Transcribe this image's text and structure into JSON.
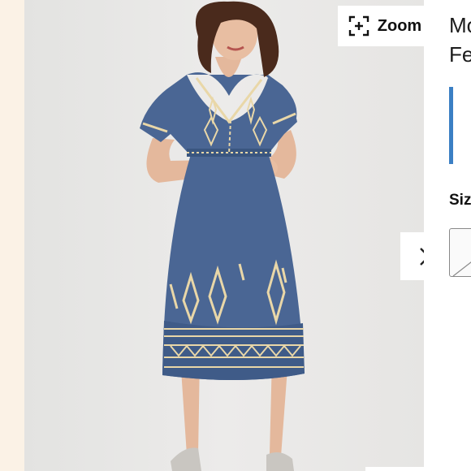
{
  "toolbar": {
    "zoom_label": "Zoom",
    "zoom_icon": "zoom-expand-icon"
  },
  "carousel": {
    "next_icon": "chevron-right-icon"
  },
  "product": {
    "title_line1": "Mo",
    "title_line2": "Fe",
    "size_label": "Siz"
  },
  "colors": {
    "accent_bar": "#3b7fc4",
    "dress": "#4a6694",
    "embroidery": "#e9d7a8"
  }
}
